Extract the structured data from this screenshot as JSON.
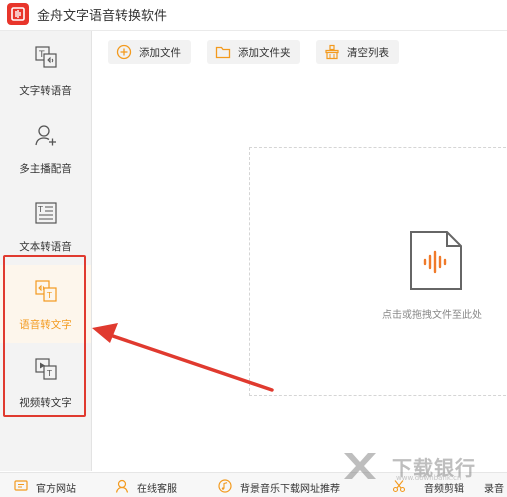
{
  "app": {
    "title": "金舟文字语音转换软件"
  },
  "sidebar": {
    "items": [
      {
        "label": "文字转语音",
        "icon": "text-to-voice-icon"
      },
      {
        "label": "多主播配音",
        "icon": "person-add-icon"
      },
      {
        "label": "文本转语音",
        "icon": "document-text-icon"
      },
      {
        "label": "语音转文字",
        "icon": "voice-to-text-icon",
        "active": true
      },
      {
        "label": "视频转文字",
        "icon": "video-to-text-icon"
      }
    ]
  },
  "toolbar": {
    "add_file": "添加文件",
    "add_folder": "添加文件夹",
    "clear_list": "清空列表"
  },
  "dropzone": {
    "hint": "点击或拖拽文件至此处"
  },
  "footer": {
    "items": [
      {
        "label": "官方网站",
        "icon": "website-icon"
      },
      {
        "label": "在线客服",
        "icon": "support-icon"
      },
      {
        "label": "背景音乐下载网址推荐",
        "icon": "music-note-icon"
      },
      {
        "label": "音频剪辑",
        "icon": "scissors-icon"
      },
      {
        "label": "录音"
      }
    ]
  },
  "watermark": {
    "text": "下载银行",
    "url": "www.downbank.cn"
  },
  "colors": {
    "accent": "#f39a1e",
    "brand": "#e8352b",
    "highlight": "#e03a2f"
  }
}
